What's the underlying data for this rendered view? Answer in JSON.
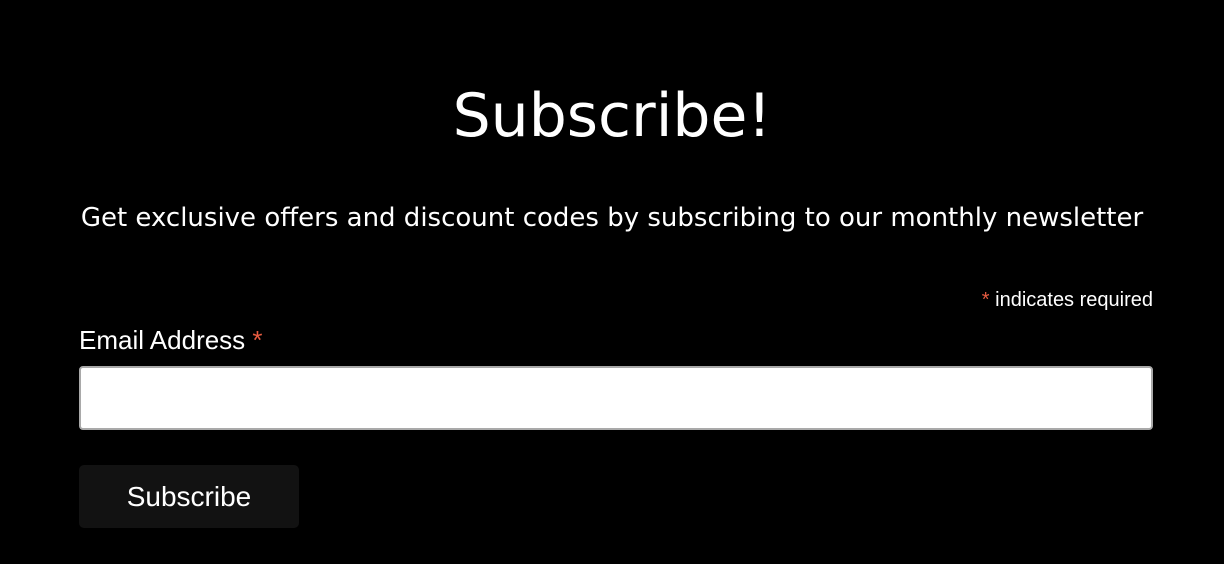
{
  "header": {
    "title": "Subscribe!",
    "subtitle": "Get exclusive offers and discount codes by subscribing to our monthly newsletter"
  },
  "form": {
    "required_marker": "*",
    "required_note": "indicates required",
    "email": {
      "label": "Email Address",
      "required_marker": "*",
      "value": "",
      "placeholder": ""
    },
    "submit_label": "Subscribe"
  },
  "colors": {
    "background": "#000000",
    "text": "#ffffff",
    "required_accent": "#e85c41",
    "button_background": "#121212",
    "input_background": "#ffffff"
  }
}
